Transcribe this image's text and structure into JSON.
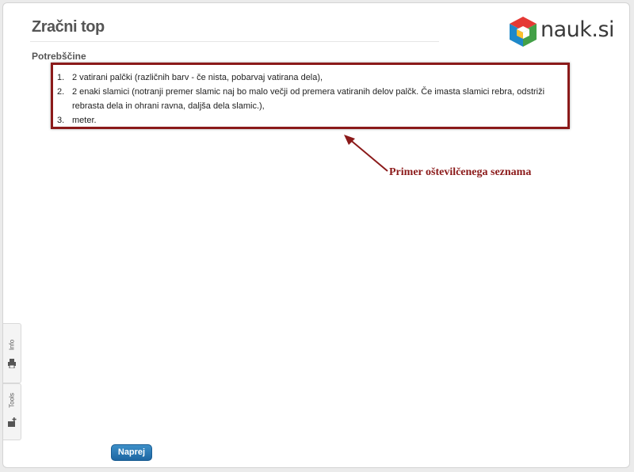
{
  "page": {
    "title": "Zračni top",
    "section_heading": "Potrebščine"
  },
  "logo": {
    "text": "nauk.si"
  },
  "requirements": [
    {
      "number": "1.",
      "text": "2 vatirani palčki (različnih barv - če nista, pobarvaj vatirana dela),"
    },
    {
      "number": "2.",
      "text": "2 enaki slamici (notranji premer slamic naj bo malo večji od premera vatiranih delov palčk. Če imasta slamici rebra, odstriži rebrasta dela in ohrani ravna, daljša dela slamic.),"
    },
    {
      "number": "3.",
      "text": "meter."
    }
  ],
  "annotation": {
    "text": "Primer oštevilčenega seznama"
  },
  "side_tabs": {
    "info": "Info",
    "tools": "Tools"
  },
  "buttons": {
    "next": "Naprej"
  },
  "colors": {
    "annotation": "#8b1a1a",
    "button": "#2a78b6",
    "title": "#555555"
  }
}
